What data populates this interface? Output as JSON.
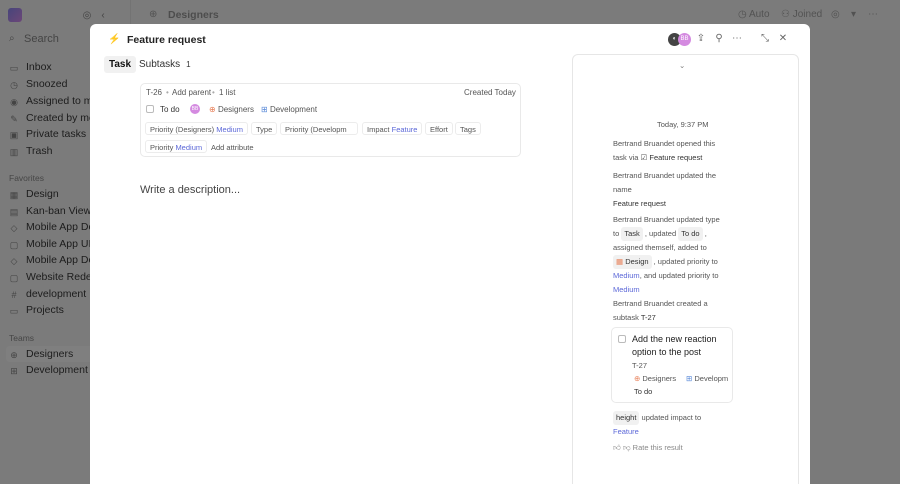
{
  "sidebar": {
    "search": "Search",
    "items": [
      {
        "label": "Inbox",
        "icon": "inbox-icon"
      },
      {
        "label": "Snoozed",
        "icon": "clock-icon"
      },
      {
        "label": "Assigned to me",
        "icon": "user-circle-icon"
      },
      {
        "label": "Created by me",
        "icon": "pencil-icon"
      },
      {
        "label": "Private tasks",
        "icon": "lock-icon"
      },
      {
        "label": "Trash",
        "icon": "trash-icon"
      }
    ],
    "favorites_title": "Favorites",
    "favorites": [
      {
        "label": "Design",
        "icon": "grid-icon"
      },
      {
        "label": "Kan-ban View",
        "icon": "board-icon"
      },
      {
        "label": "Mobile App Desi",
        "icon": "diamond-icon"
      },
      {
        "label": "Mobile App UI/U",
        "icon": "box-icon"
      },
      {
        "label": "Mobile App Desi",
        "icon": "diamond-icon"
      },
      {
        "label": "Website Redesig",
        "icon": "box-icon"
      },
      {
        "label": "development",
        "icon": "hash-icon"
      },
      {
        "label": "Projects",
        "icon": "briefcase-icon"
      }
    ],
    "teams_title": "Teams",
    "teams": [
      {
        "label": "Designers",
        "icon": "team-icon"
      },
      {
        "label": "Development",
        "icon": "team-icon"
      }
    ]
  },
  "topbar": {
    "title": "Designers",
    "auto": "Auto",
    "joined": "Joined"
  },
  "modal": {
    "title": "Feature request",
    "tabs": [
      {
        "label": "Task"
      },
      {
        "label": "Subtasks",
        "count": "1"
      }
    ],
    "card": {
      "id": "T-26",
      "add_parent": "Add parent",
      "list": "1 list",
      "created": "Created Today",
      "status": "To do",
      "avatar": "BB",
      "team1": "Designers",
      "team2": "Development",
      "prio_designers_label": "Priority (Designers)",
      "prio_designers_value": "Medium",
      "type": "Type",
      "prio_dev_label": "Priority (Developm",
      "impact_label": "Impact",
      "impact_value": "Feature",
      "effort": "Effort",
      "tags": "Tags",
      "prio_label": "Priority",
      "prio_value": "Medium",
      "add_attribute": "Add attribute"
    },
    "description_placeholder": "Write a description..."
  },
  "activity": {
    "date": "Today, 9:37 PM",
    "e1a": "Bertrand Bruandet opened this",
    "e1b": "task via",
    "e1c": "Feature request",
    "e2a": "Bertrand Bruandet updated the",
    "e2b": "name",
    "e2c": "Feature request",
    "e3a": "Bertrand Bruandet updated type",
    "e3b": "to",
    "e3c": "Task",
    "e3d": ", updated",
    "e3e": "To do",
    "e3f": ",",
    "e3g": "assigned themself, added to",
    "e3h": "Design",
    "e3i": ", updated priority to",
    "e3j": "Medium",
    "e3k": ", and updated priority to",
    "e3l": "Medium",
    "e4a": "Bertrand Bruandet created a",
    "e4b": "subtask",
    "e4c": "T-27",
    "sub_title": "Add the new reaction option to the post",
    "sub_id": "T-27",
    "sub_team1": "Designers",
    "sub_team2": "Developm",
    "sub_status": "To do",
    "e5a": "height",
    "e5b": "updated impact to",
    "e5c": "Feature",
    "rate": "Rate this result"
  },
  "colors": {
    "accent": "#5c68d8",
    "designers": "#e8815a",
    "development": "#5a8ad8"
  }
}
